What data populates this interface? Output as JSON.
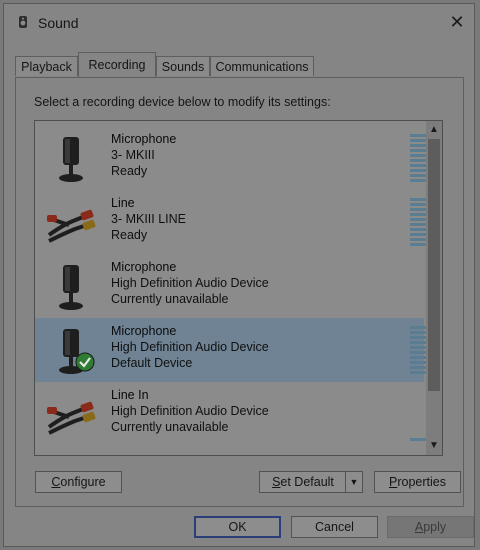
{
  "window": {
    "title": "Sound",
    "close_label": "✕"
  },
  "tabs": [
    {
      "label": "Playback"
    },
    {
      "label": "Recording"
    },
    {
      "label": "Sounds"
    },
    {
      "label": "Communications"
    }
  ],
  "active_tab": "Recording",
  "instruction": "Select a recording device below to modify its settings:",
  "devices": [
    {
      "name": "Microphone",
      "detail": "3- MKIII",
      "status": "Ready",
      "icon": "microphone-icon",
      "selected": false
    },
    {
      "name": "Line",
      "detail": "3- MKIII LINE",
      "status": "Ready",
      "icon": "line-cable-icon",
      "selected": false
    },
    {
      "name": "Microphone",
      "detail": "High Definition Audio Device",
      "status": "Currently unavailable",
      "icon": "microphone-icon",
      "selected": false
    },
    {
      "name": "Microphone",
      "detail": "High Definition Audio Device",
      "status": "Default Device",
      "icon": "microphone-icon",
      "selected": true,
      "default_badge": "checkmark-icon"
    },
    {
      "name": "Line In",
      "detail": "High Definition Audio Device",
      "status": "Currently unavailable",
      "icon": "line-cable-icon",
      "selected": false
    }
  ],
  "buttons": {
    "configure": {
      "underline": "C",
      "rest": "onfigure"
    },
    "set_default": {
      "underline": "S",
      "rest": "et Default"
    },
    "properties": {
      "underline": "P",
      "rest": "roperties"
    },
    "ok": "OK",
    "cancel": "Cancel",
    "apply": {
      "underline": "A",
      "rest": "pply"
    }
  },
  "colors": {
    "selection": "#6f8394",
    "level_meter": "#5a7d92",
    "check_badge": "#2e7d32"
  }
}
